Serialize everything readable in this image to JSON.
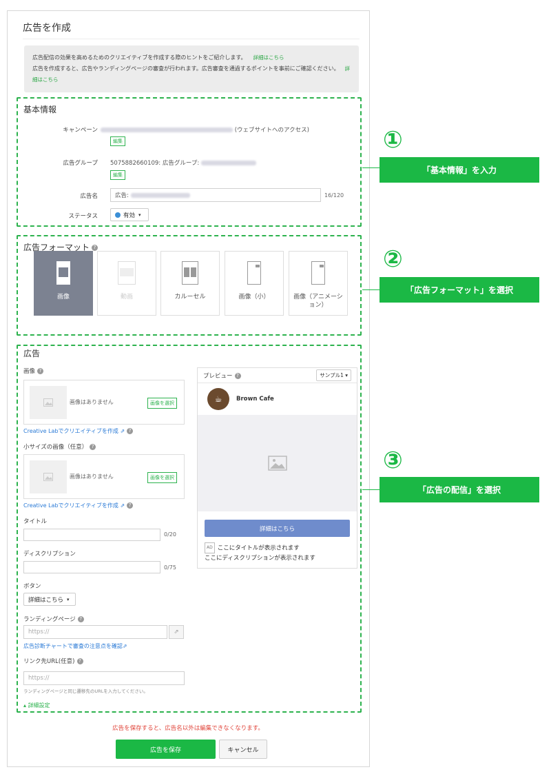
{
  "page": {
    "title": "広告を作成"
  },
  "hint": {
    "line1": "広告配信の効果を高めるためのクリエイティブを作成する際のヒントをご紹介します。",
    "link1": "詳細はこちら",
    "line2": "広告を作成すると、広告やランディングページの審査が行われます。広告審査を通過するポイントを事前にご確認ください。",
    "link2": "詳細はこちら"
  },
  "basic": {
    "title": "基本情報",
    "campaign_label": "キャンペーン",
    "campaign_suffix": "(ウェブサイトへのアクセス)",
    "edit_label": "編集",
    "group_label": "広告グループ",
    "group_value": "5075882660109: 広告グループ:",
    "name_label": "広告名",
    "name_value": "広告:",
    "name_count": "16/120",
    "status_label": "ステータス",
    "status_value": "有効"
  },
  "format": {
    "title": "広告フォーマット",
    "options": [
      {
        "label": "画像"
      },
      {
        "label": "動画"
      },
      {
        "label": "カルーセル"
      },
      {
        "label": "画像（小）"
      },
      {
        "label": "画像（アニメーション）"
      }
    ]
  },
  "ad": {
    "title": "広告",
    "image_label": "画像",
    "no_image": "画像はありません",
    "select_image": "画像を選択",
    "creative_lab": "Creative Labでクリエイティブを作成",
    "small_image_label": "小サイズの画像（任意）",
    "title_label": "タイトル",
    "title_count": "0/20",
    "desc_label": "ディスクリプション",
    "desc_count": "0/75",
    "button_label": "ボタン",
    "button_value": "詳細はこちら",
    "landing_label": "ランディングページ",
    "landing_placeholder": "https://",
    "landing_check": "広告診断チャートで審査の注意点を確認",
    "link_url_label": "リンク先URL(任意)",
    "link_url_placeholder": "https://",
    "link_url_help": "ランディングページと同じ遷移先のURLを入力してください。",
    "advanced": "詳細設定"
  },
  "preview": {
    "title": "プレビュー",
    "sample": "サンプル1",
    "brand": "Brown Cafe",
    "cta": "詳細はこちら",
    "ad_tag": "AD",
    "title_placeholder": "ここにタイトルが表示されます",
    "desc_placeholder": "ここにディスクリプションが表示されます"
  },
  "footer": {
    "warning": "広告を保存すると、広告名以外は編集できなくなります。",
    "save": "広告を保存",
    "cancel": "キャンセル"
  },
  "callouts": [
    {
      "number": "①",
      "text": "「基本情報」を入力"
    },
    {
      "number": "②",
      "text": "「広告フォーマット」を選択"
    },
    {
      "number": "③",
      "text": "「広告の配信」を選択"
    }
  ],
  "colors": {
    "accent": "#1bb845",
    "link": "#2a7ad6",
    "warning": "#e0443a",
    "preview_button": "#6f8ccc"
  }
}
